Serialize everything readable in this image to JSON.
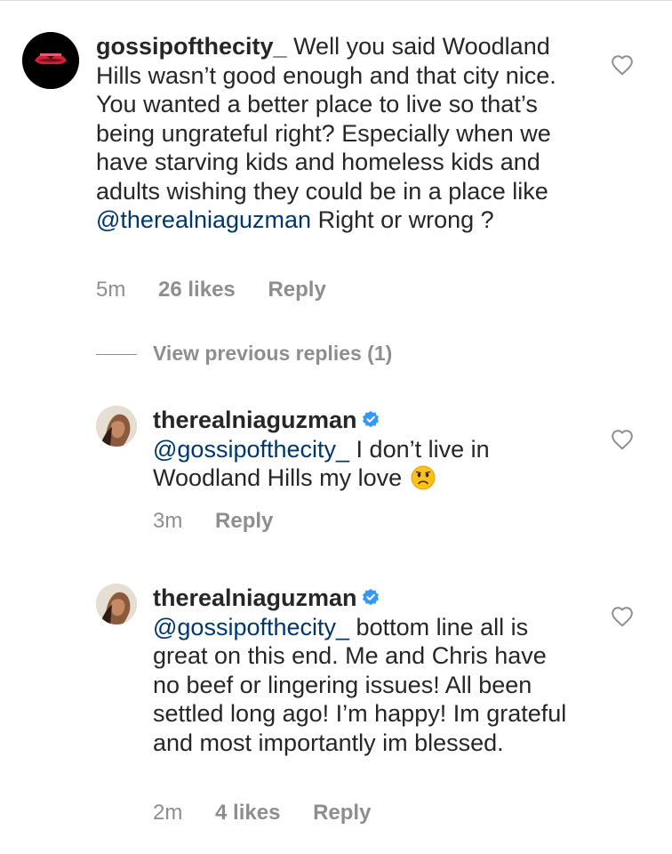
{
  "comment": {
    "username": "gossipofthecity_",
    "text_before_mention": "Well you said Woodland Hills wasn’t good enough and that city nice. You wanted a better place to live so that’s being ungrateful right? Especially when we have starving kids and homeless kids and adults wishing they could be in a place like",
    "mention": "@therealniaguzman",
    "text_after_mention": "Right or wrong ?",
    "time": "5m",
    "likes": "26 likes",
    "reply_label": "Reply"
  },
  "view_previous_replies": "View previous replies (1)",
  "replies": [
    {
      "username": "therealniaguzman",
      "mention": "@gossipofthecity_",
      "text": "I don’t live in Woodland Hills my love",
      "time": "3m",
      "reply_label": "Reply"
    },
    {
      "username": "therealniaguzman",
      "mention": "@gossipofthecity_",
      "text": "bottom line all is great on this end. Me and Chris have no beef or lingering issues! All been settled long ago! I’m happy! Im grateful and most importantly im blessed.",
      "time": "2m",
      "likes": "4 likes",
      "reply_label": "Reply"
    }
  ],
  "colors": {
    "text": "#262626",
    "secondary": "#8e8e8e",
    "mention": "#00376b",
    "verified": "#3897f0"
  },
  "icons": [
    "heart-outline-icon",
    "verified-badge-icon",
    "worried-face-emoji"
  ]
}
